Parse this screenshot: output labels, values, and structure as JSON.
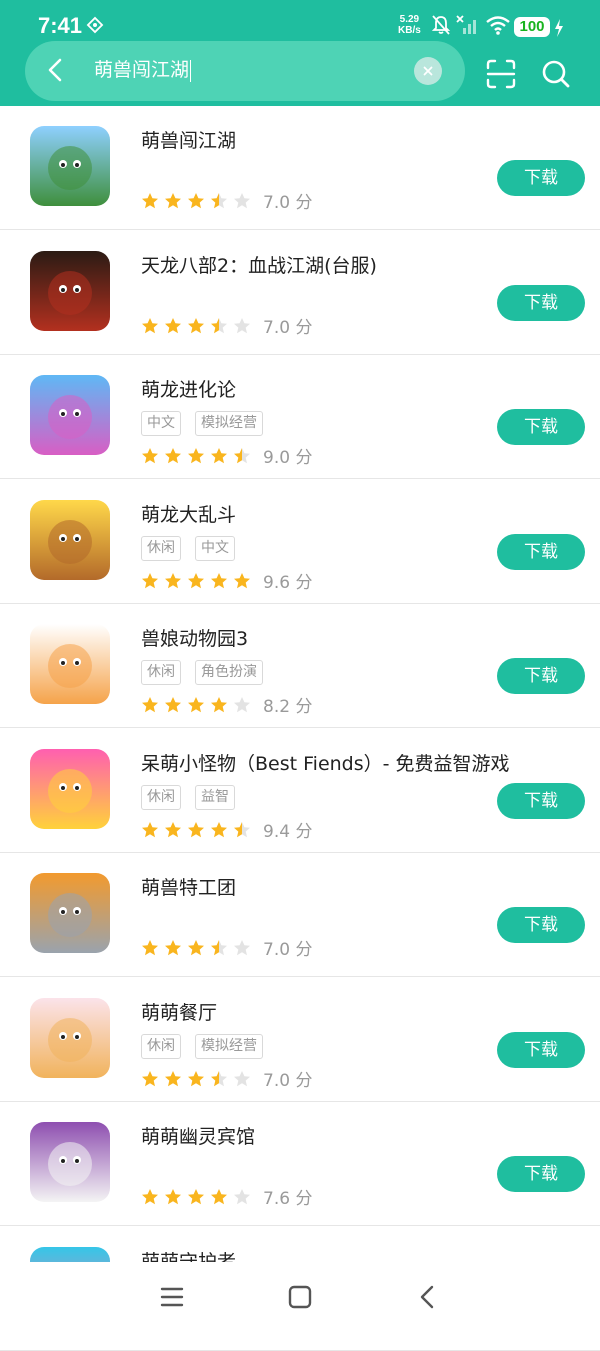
{
  "status": {
    "time": "7:41",
    "speed_value": "5.29",
    "speed_unit": "KB/s",
    "battery": "100"
  },
  "search": {
    "query": "萌兽闯江湖",
    "clear_symbol": "×"
  },
  "download_label": "下载",
  "score_unit": "分",
  "apps": [
    {
      "title": "萌兽闯江湖",
      "tags": [],
      "rating": 3.5,
      "score": "7.0",
      "icon": "panda-warrior-icon",
      "colors": [
        "#8fd0ff",
        "#3f8f3c"
      ]
    },
    {
      "title": "天龙八部2：血战江湖(台服)",
      "tags": [],
      "rating": 3.5,
      "score": "7.0",
      "icon": "blood-warrior-icon",
      "colors": [
        "#2b1b14",
        "#b3301f"
      ]
    },
    {
      "title": "萌龙进化论",
      "tags": [
        "中文",
        "模拟经营"
      ],
      "rating": 4.5,
      "score": "9.0",
      "icon": "dragon-egg-icon",
      "colors": [
        "#5fb8f5",
        "#d85ec4"
      ]
    },
    {
      "title": "萌龙大乱斗",
      "tags": [
        "休闲",
        "中文"
      ],
      "rating": 5,
      "score": "9.6",
      "icon": "cookie-icon",
      "colors": [
        "#ffd84a",
        "#b36a2a"
      ]
    },
    {
      "title": "兽娘动物园3",
      "tags": [
        "休闲",
        "角色扮演"
      ],
      "rating": 4,
      "score": "8.2",
      "icon": "animal-girls-icon",
      "colors": [
        "#ffffff",
        "#f5a34a"
      ]
    },
    {
      "title": "呆萌小怪物（Best Fiends）- 免费益智游戏",
      "tags": [
        "休闲",
        "益智"
      ],
      "rating": 4.5,
      "score": "9.4",
      "icon": "pink-monster-icon",
      "colors": [
        "#ff5fb0",
        "#ffd23a"
      ]
    },
    {
      "title": "萌兽特工团",
      "tags": [],
      "rating": 3.5,
      "score": "7.0",
      "icon": "knight-fox-icon",
      "colors": [
        "#f29a2e",
        "#9aa3ad"
      ]
    },
    {
      "title": "萌萌餐厅",
      "tags": [
        "休闲",
        "模拟经营"
      ],
      "rating": 3.5,
      "score": "7.0",
      "icon": "chef-girl-icon",
      "colors": [
        "#fbe3ea",
        "#f1b35c"
      ]
    },
    {
      "title": "萌萌幽灵宾馆",
      "tags": [],
      "rating": 4,
      "score": "7.6",
      "icon": "ghost-waiter-icon",
      "colors": [
        "#8e4fb0",
        "#f4f4f4"
      ]
    },
    {
      "title": "萌萌守护者",
      "tags": [],
      "rating": 0,
      "score": "",
      "icon": "guardian-icon",
      "colors": [
        "#35c6e8",
        "#ff7aa8"
      ]
    }
  ],
  "colors": {
    "accent": "#1fbe9f",
    "star_on": "#f9b51e",
    "star_off": "#e3e3e3"
  }
}
